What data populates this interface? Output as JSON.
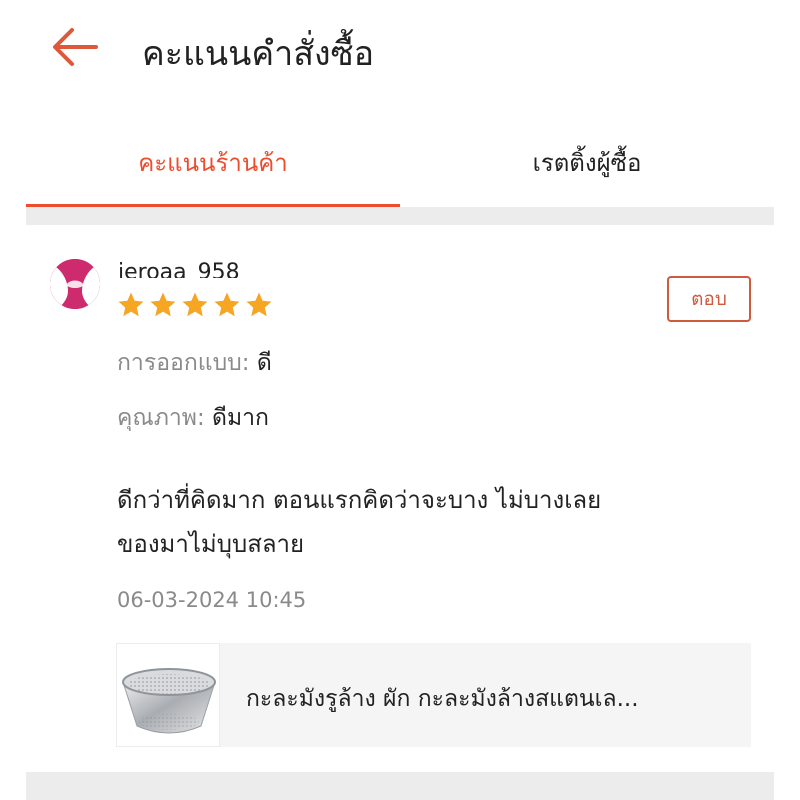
{
  "header": {
    "title": "คะแนนคำสั่งซื้อ",
    "back_icon": "arrow-left-icon",
    "accent_color": "#ee4d2d"
  },
  "tabs": [
    {
      "label": "คะแนนร้านค้า",
      "active": true
    },
    {
      "label": "เรตติ้งผู้ซื้อ",
      "active": false
    }
  ],
  "review": {
    "username": "ieroaa_958",
    "rating": 5,
    "max_rating": 5,
    "star_color": "#f6a623",
    "reply_label": "ตอบ",
    "attributes": [
      {
        "key": "การออกแบบ:",
        "value": "ดี"
      },
      {
        "key": "คุณภาพ:",
        "value": "ดีมาก"
      }
    ],
    "text_lines": [
      "ดีกว่าที่คิดมาก ตอนแรกคิดว่าจะบาง ไม่บางเลย",
      "ของมาไม่บุบสลาย"
    ],
    "date": "06-03-2024 10:45",
    "product": {
      "name": "กะละมังรูล้าง ผัก กะละมังล้างสแตนเล...",
      "thumbnail": "stainless-colander-bowl-image"
    }
  }
}
